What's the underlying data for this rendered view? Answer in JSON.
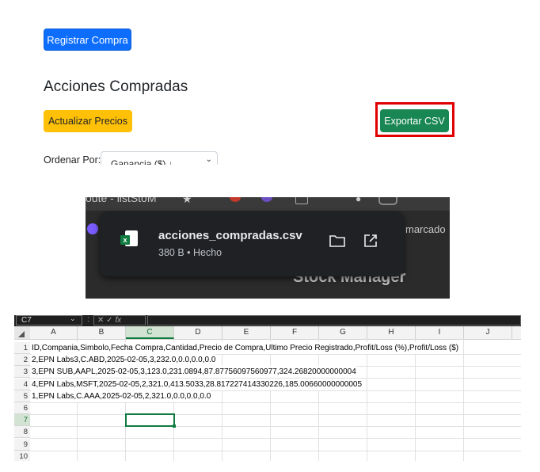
{
  "app": {
    "register_button": "Registrar Compra",
    "section_title": "Acciones Compradas",
    "refresh_button": "Actualizar Precios",
    "export_button": "Exportar CSV",
    "order_label": "Ordenar Por:",
    "order_value": "Ganancia ($) ↓"
  },
  "download_popup": {
    "background_text": "oute - listStoM",
    "filename": "acciones_compradas.csv",
    "status": "380 B • Hecho",
    "side_text": "marcado",
    "bottom_text": "Stock Manager",
    "file_icon_letter": "x",
    "file_icon": "excel-file-icon",
    "folder_icon": "folder-icon",
    "open_icon": "open-external-icon"
  },
  "spreadsheet": {
    "name_box": "C7",
    "fx_label": "fx",
    "columns": [
      "A",
      "B",
      "C",
      "D",
      "E",
      "F",
      "G",
      "H",
      "I",
      "J"
    ],
    "active_column": "C",
    "rows": [
      {
        "num": "1",
        "text": "ID,Compania,Simbolo,Fecha Compra,Cantidad,Precio de Compra,Ultimo Precio Registrado,Profit/Loss (%),Profit/Loss ($)"
      },
      {
        "num": "2",
        "text": "2,EPN Labs3,C.ABD,2025-02-05,3,232.0,0.0,0.0,0.0"
      },
      {
        "num": "3",
        "text": "3,EPN SUB,AAPL,2025-02-05,3,123.0,231.0894,87.87756097560977,324.26820000000004"
      },
      {
        "num": "4",
        "text": "4,EPN Labs,MSFT,2025-02-05,2,321.0,413.5033,28.817227414330226,185.00660000000005"
      },
      {
        "num": "5",
        "text": "1,EPN Labs,C.AAA,2025-02-05,2,321.0,0.0,0.0,0.0"
      },
      {
        "num": "6",
        "text": ""
      },
      {
        "num": "7",
        "text": ""
      },
      {
        "num": "8",
        "text": ""
      },
      {
        "num": "9",
        "text": ""
      },
      {
        "num": "10",
        "text": ""
      }
    ]
  },
  "colors": {
    "primary": "#0d6efd",
    "warning": "#ffc107",
    "success": "#198754",
    "highlight": "#e00000",
    "excel_green": "#107c41"
  }
}
